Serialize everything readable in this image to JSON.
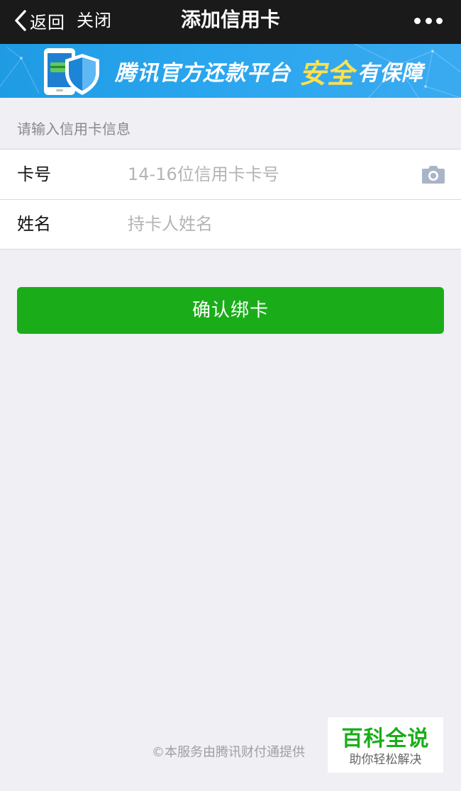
{
  "nav": {
    "back_label": "返回",
    "close_label": "关闭",
    "title": "添加信用卡"
  },
  "banner": {
    "text_left": "腾讯官方还款平台",
    "text_highlight": "安全",
    "text_right": "有保障"
  },
  "form": {
    "section_label": "请输入信用卡信息",
    "card_number": {
      "label": "卡号",
      "placeholder": "14-16位信用卡卡号",
      "value": ""
    },
    "name": {
      "label": "姓名",
      "placeholder": "持卡人姓名",
      "value": ""
    }
  },
  "confirm_label": "确认绑卡",
  "footer": {
    "credit": "©本服务由腾讯财付通提供"
  },
  "watermark": {
    "title": "百科全说",
    "subtitle": "助你轻松解决"
  },
  "colors": {
    "nav_bg": "#1a1a1a",
    "banner_bg": "#2aa6ee",
    "banner_highlight": "#ffe14d",
    "primary_green": "#1aad19",
    "page_bg": "#efeff4",
    "placeholder": "#b4b4b4"
  },
  "icons": {
    "back": "chevron-left-icon",
    "more": "more-dots-icon",
    "camera": "camera-icon"
  }
}
